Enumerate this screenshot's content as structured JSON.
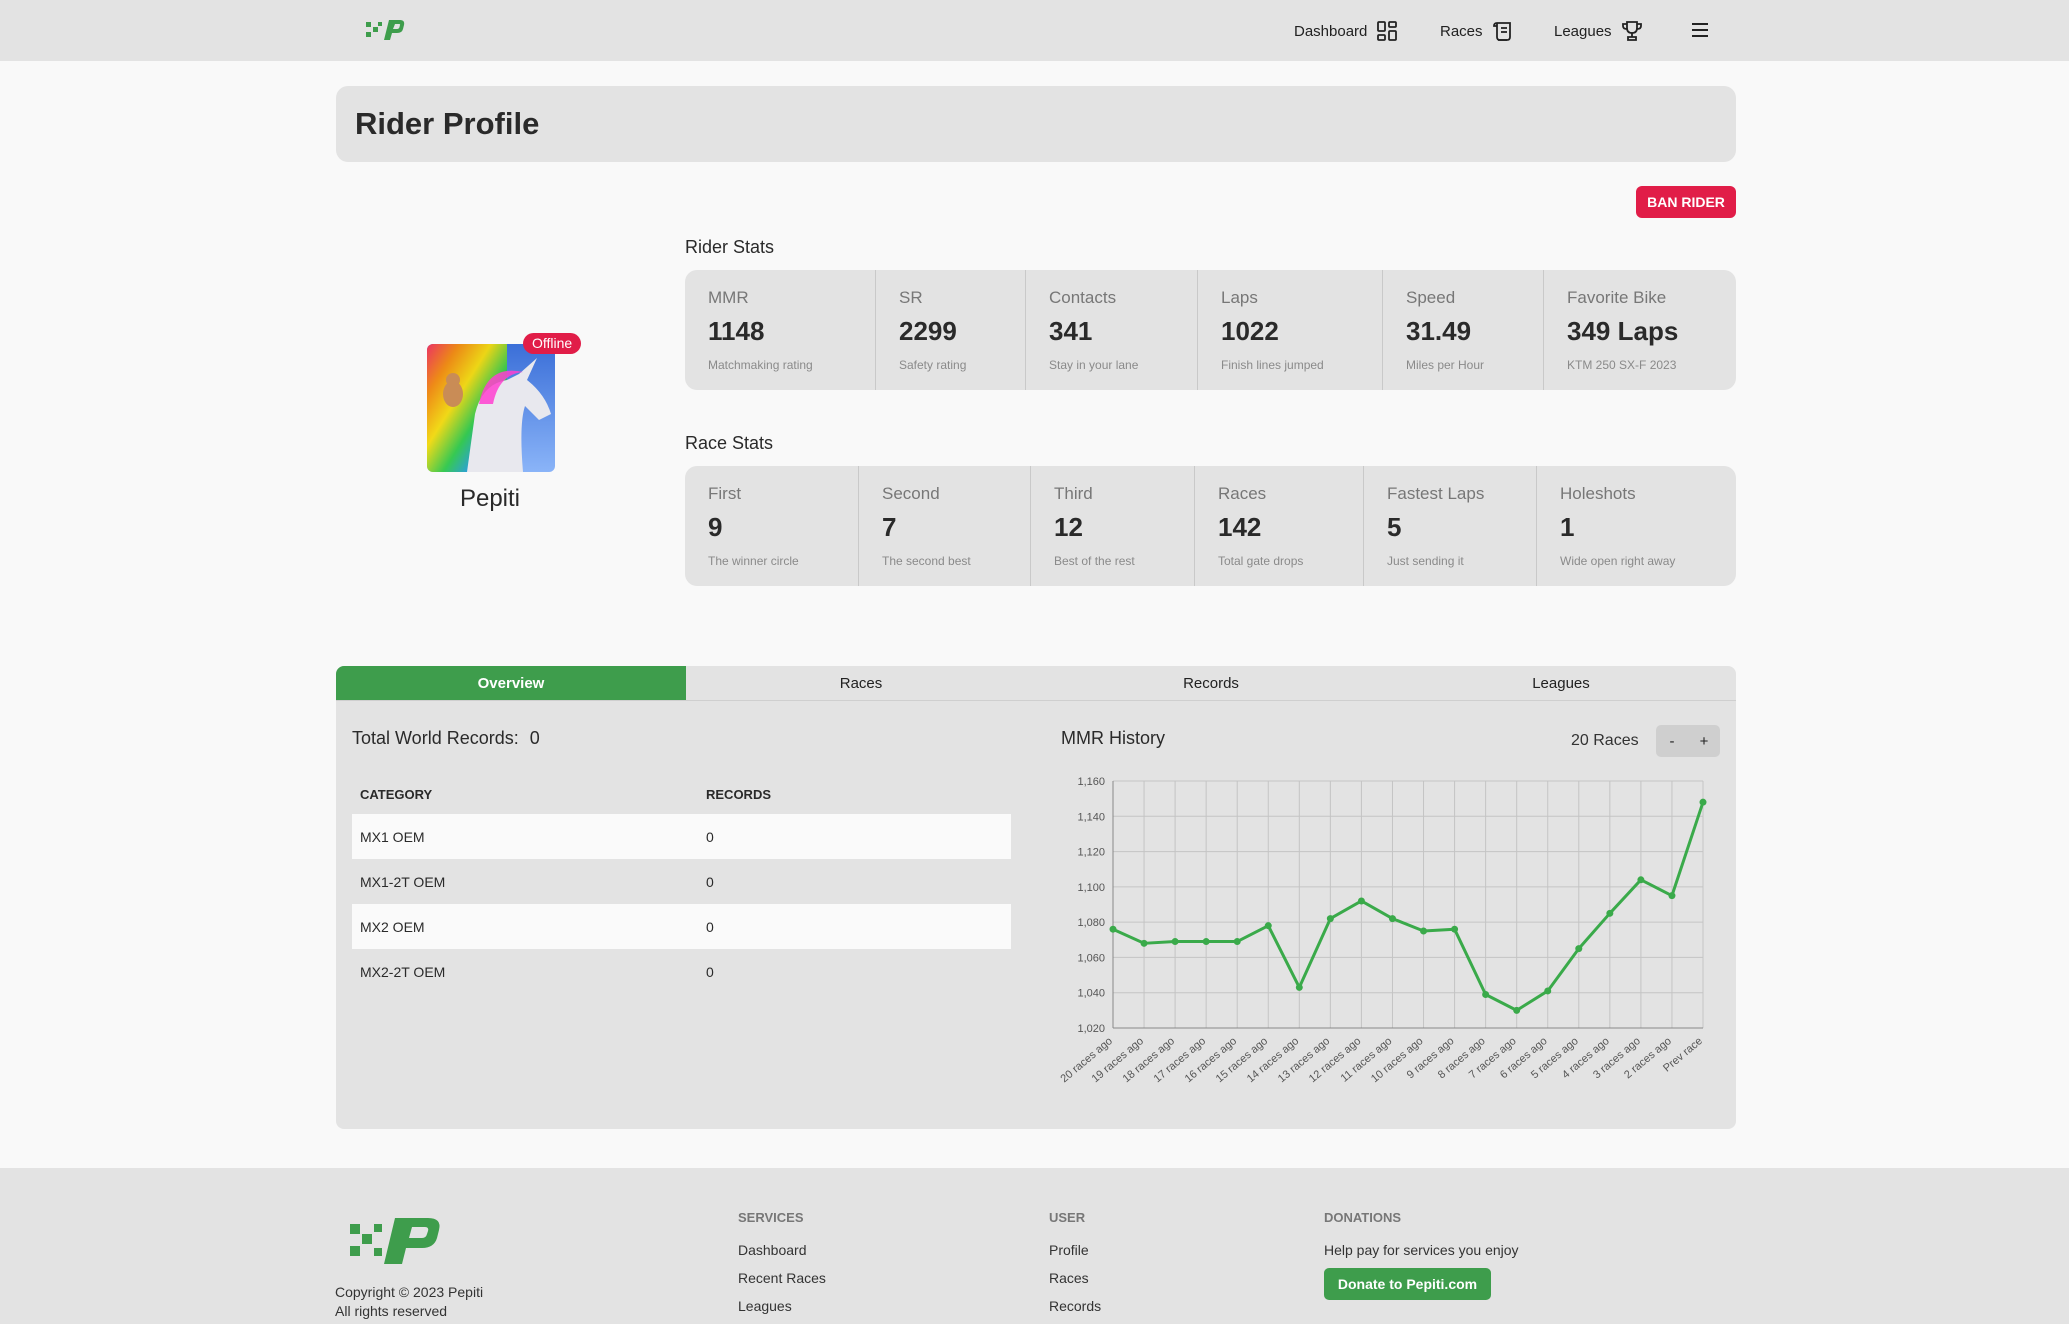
{
  "nav": {
    "items": [
      {
        "label": "Dashboard",
        "icon": "dashboard-grid-icon"
      },
      {
        "label": "Races",
        "icon": "scroll-icon"
      },
      {
        "label": "Leagues",
        "icon": "trophy-icon"
      }
    ],
    "menu_icon": "hamburger-menu-icon"
  },
  "page": {
    "title": "Rider Profile",
    "ban_label": "BAN RIDER"
  },
  "rider": {
    "name": "Pepiti",
    "status": "Offline"
  },
  "rider_stats": {
    "title": "Rider Stats",
    "items": [
      {
        "label": "MMR",
        "value": "1148",
        "desc": "Matchmaking rating"
      },
      {
        "label": "SR",
        "value": "2299",
        "desc": "Safety rating"
      },
      {
        "label": "Contacts",
        "value": "341",
        "desc": "Stay in your lane"
      },
      {
        "label": "Laps",
        "value": "1022",
        "desc": "Finish lines jumped"
      },
      {
        "label": "Speed",
        "value": "31.49",
        "desc": "Miles per Hour"
      },
      {
        "label": "Favorite Bike",
        "value": "349 Laps",
        "desc": "KTM 250 SX-F 2023"
      }
    ]
  },
  "race_stats": {
    "title": "Race Stats",
    "items": [
      {
        "label": "First",
        "value": "9",
        "desc": "The winner circle"
      },
      {
        "label": "Second",
        "value": "7",
        "desc": "The second best"
      },
      {
        "label": "Third",
        "value": "12",
        "desc": "Best of the rest"
      },
      {
        "label": "Races",
        "value": "142",
        "desc": "Total gate drops"
      },
      {
        "label": "Fastest Laps",
        "value": "5",
        "desc": "Just sending it"
      },
      {
        "label": "Holeshots",
        "value": "1",
        "desc": "Wide open right away"
      }
    ]
  },
  "tabs": [
    "Overview",
    "Races",
    "Records",
    "Leagues"
  ],
  "active_tab": "Overview",
  "world_records": {
    "title": "Total World Records:",
    "total": "0",
    "headers": [
      "CATEGORY",
      "RECORDS"
    ],
    "rows": [
      {
        "category": "MX1 OEM",
        "records": "0"
      },
      {
        "category": "MX1-2T OEM",
        "records": "0"
      },
      {
        "category": "MX2 OEM",
        "records": "0"
      },
      {
        "category": "MX2-2T OEM",
        "records": "0"
      }
    ]
  },
  "mmr_history": {
    "title": "MMR History",
    "races_label": "20 Races",
    "minus": "-",
    "plus": "+"
  },
  "chart_data": {
    "type": "line",
    "title": "MMR History",
    "categories": [
      "20 races ago",
      "19 races ago",
      "18 races ago",
      "17 races ago",
      "16 races ago",
      "15 races ago",
      "14 races ago",
      "13 races ago",
      "12 races ago",
      "11 races ago",
      "10 races ago",
      "9 races ago",
      "8 races ago",
      "7 races ago",
      "6 races ago",
      "5 races ago",
      "4 races ago",
      "3 races ago",
      "2 races ago",
      "Prev race"
    ],
    "series": [
      {
        "values": [
          1076,
          1068,
          1069,
          1069,
          1069,
          1078,
          1043,
          1082,
          1092,
          1082,
          1075,
          1076,
          1039,
          1030,
          1041,
          1065,
          1085,
          1104,
          1095,
          1148
        ],
        "color": "#3aaa4a"
      }
    ],
    "ylim": [
      1020,
      1160
    ],
    "yticks": [
      "1,020",
      "1,040",
      "1,060",
      "1,080",
      "1,100",
      "1,120",
      "1,140",
      "1,160"
    ],
    "grid": true
  },
  "footer": {
    "copyright": "Copyright © 2023 Pepiti",
    "rights": "All rights reserved",
    "services": {
      "heading": "SERVICES",
      "links": [
        "Dashboard",
        "Recent Races",
        "Leagues"
      ]
    },
    "user": {
      "heading": "USER",
      "links": [
        "Profile",
        "Races",
        "Records"
      ]
    },
    "donations": {
      "heading": "DONATIONS",
      "text": "Help pay for services you enjoy",
      "button": "Donate to Pepiti.com"
    }
  },
  "colors": {
    "brand_green": "#3e9d4c",
    "danger": "#e11d48"
  }
}
